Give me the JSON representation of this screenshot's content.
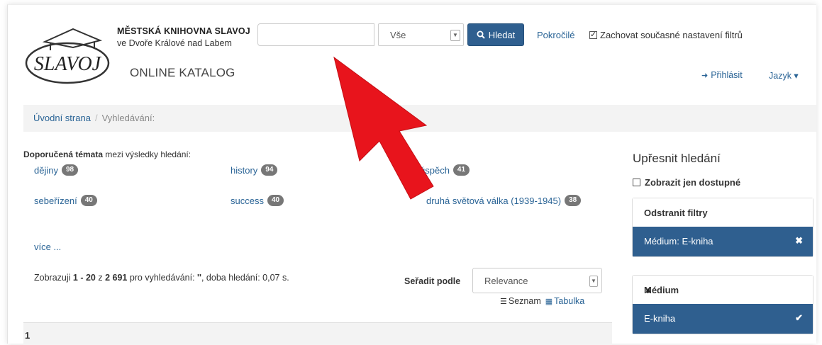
{
  "header": {
    "library_name": "MĚSTSKÁ KNIHOVNA SLAVOJ",
    "library_sub": "ve Dvoře Králové nad Labem",
    "catalog_title": "ONLINE KATALOG",
    "logo_text": "SLAVOJ"
  },
  "search": {
    "value": "",
    "placeholder": "",
    "type_value": "Vše",
    "button_label": "Hledat",
    "advanced_label": "Pokročilé",
    "keep_filters_label": "Zachovat současné nastavení filtrů",
    "keep_filters_checked": true
  },
  "nav": {
    "login_label": "Přihlásit",
    "language_label": "Jazyk ▾"
  },
  "breadcrumb": {
    "home": "Úvodní strana",
    "separator": "/",
    "current": "Vyhledávání:"
  },
  "topics": {
    "title_bold": "Doporučená témata",
    "title_rest": " mezi výsledky hledání:",
    "items": [
      {
        "label": "dějiny",
        "count": "98"
      },
      {
        "label": "history",
        "count": "94"
      },
      {
        "label": "úspěch",
        "count": "41"
      },
      {
        "label": "sebeřízení",
        "count": "40"
      },
      {
        "label": "success",
        "count": "40"
      },
      {
        "label": "druhá světová válka (1939-1945)",
        "count": "38"
      }
    ],
    "more_label": "více ..."
  },
  "results": {
    "prefix": "Zobrazuji ",
    "range": "1 - 20",
    "of": " z ",
    "total": "2 691",
    "query_text": " pro vyhledávání: ",
    "query": "''",
    "time_text": ", doba hledání: 0,07 s.",
    "sort_label": "Seřadit podle",
    "sort_value": "Relevance",
    "view_list": "Seznam",
    "view_table": "Tabulka",
    "page_number": "1"
  },
  "sidebar": {
    "refine_title": "Upřesnit hledání",
    "only_available_label": "Zobrazit jen dostupné",
    "remove_filters_title": "Odstranit filtry",
    "active_filter": "Médium: E-kniha",
    "facet_title": "Médium",
    "facet_item": "E-kniha"
  },
  "colors": {
    "primary": "#2f5f8f",
    "link": "#2a6496",
    "arrow": "#e8141c",
    "badge": "#777777"
  }
}
